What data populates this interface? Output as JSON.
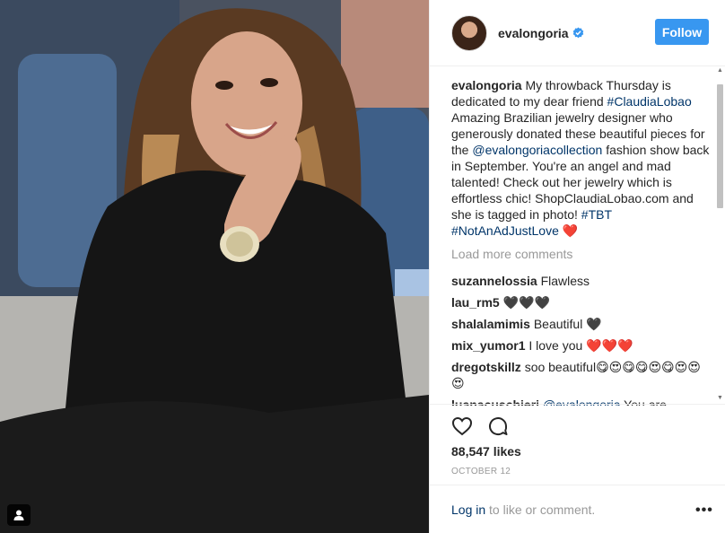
{
  "post": {
    "photo_alt": "",
    "header": {
      "username": "evalongoria",
      "verified_icon": "verified-badge-icon",
      "follow_label": "Follow"
    },
    "caption": {
      "username": "evalongoria",
      "part1": " My throwback Thursday is dedicated to my dear friend ",
      "tag1": "#ClaudiaLobao",
      "part2": " Amazing Brazilian jewelry designer who generously donated these beautiful pieces for the ",
      "mention1": "@evalongoriacollection",
      "part3": " fashion show back in September. You're an angel and mad talented! Check out her jewelry which is effortless chic! ShopClaudiaLobao.com and she is tagged in photo! ",
      "tag2": "#TBT",
      "tag3": "#NotAnAdJustLove",
      "emoji": "❤️"
    },
    "load_more": "Load more comments",
    "comments": [
      {
        "user": "suzannelossia",
        "text": "Flawless"
      },
      {
        "user": "lau_rm5",
        "text": "🖤🖤🖤"
      },
      {
        "user": "shalalamimis",
        "text": "Beautiful 🖤"
      },
      {
        "user": "mix_yumor1",
        "text": "I love you ❤️❤️❤️"
      },
      {
        "user": "dregotskillz",
        "text": "soo beautiful😋😍😋😋😍😋😍😍😍"
      },
      {
        "user": "luanacuschieri",
        "mention": "@evalongoria",
        "text": " You are"
      }
    ],
    "likes": "88,547 likes",
    "date": "OCTOBER 12",
    "footer": {
      "login": "Log in",
      "rest": " to like or comment.",
      "more": "•••"
    },
    "colors": {
      "accent": "#3897f0",
      "link": "#003569",
      "muted": "#999999"
    }
  }
}
